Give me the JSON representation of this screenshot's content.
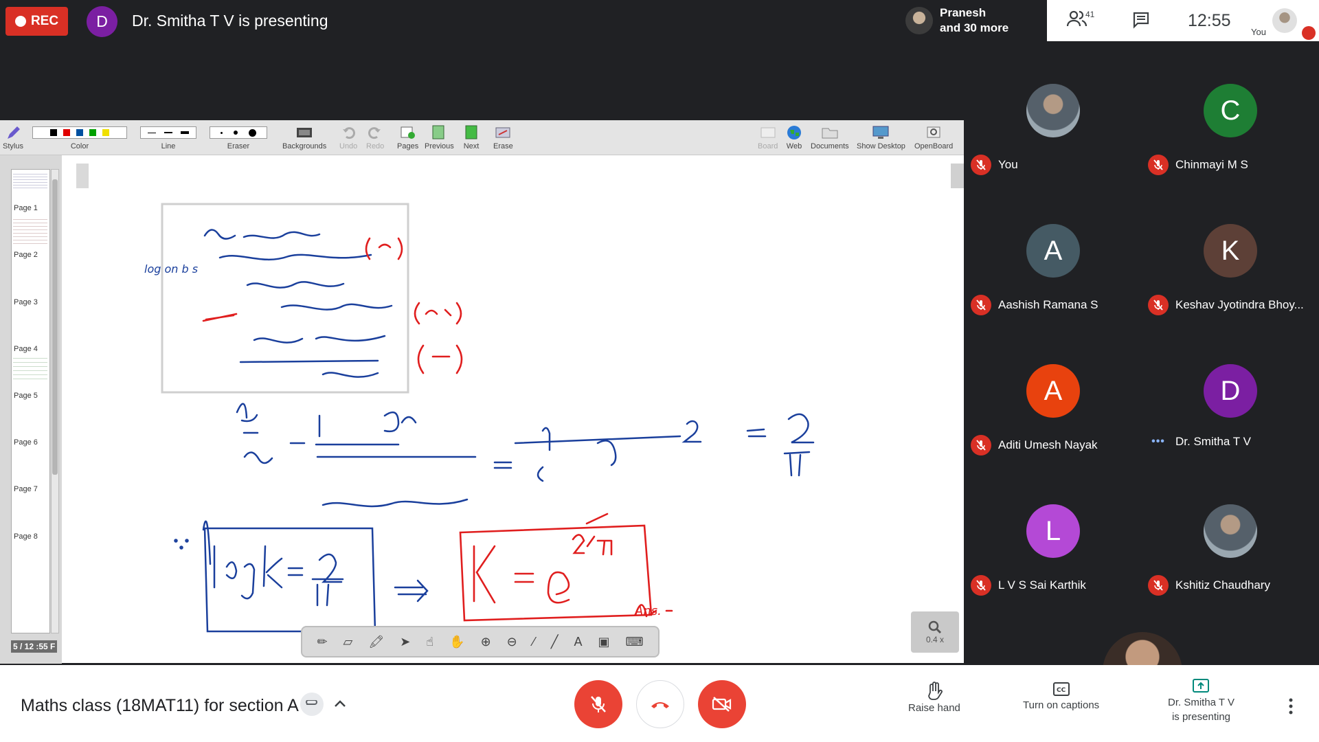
{
  "top_bar": {
    "rec_label": "REC",
    "presenter_initial": "D",
    "presenter_text": "Dr. Smitha T V is presenting",
    "speaker_line1": "Pranesh",
    "speaker_line2": "and 30 more",
    "participant_count": "41",
    "time": "12:55",
    "you_label": "You"
  },
  "whiteboard": {
    "toolbar_left": [
      {
        "label": "Stylus",
        "icon": "stylus-icon"
      },
      {
        "label": "Color",
        "icon": "color-swatches"
      },
      {
        "label": "Line",
        "icon": "line-width-icon"
      },
      {
        "label": "Eraser",
        "icon": "eraser-size-icon"
      },
      {
        "label": "Backgrounds",
        "icon": "backgrounds-icon"
      },
      {
        "label": "Undo",
        "icon": "undo-icon"
      },
      {
        "label": "Redo",
        "icon": "redo-icon"
      },
      {
        "label": "Pages",
        "icon": "pages-icon"
      },
      {
        "label": "Previous",
        "icon": "previous-icon"
      },
      {
        "label": "Next",
        "icon": "next-icon"
      },
      {
        "label": "Erase",
        "icon": "erase-icon"
      }
    ],
    "toolbar_right": [
      {
        "label": "Board",
        "icon": "board-icon"
      },
      {
        "label": "Web",
        "icon": "globe-icon"
      },
      {
        "label": "Documents",
        "icon": "folder-icon"
      },
      {
        "label": "Show Desktop",
        "icon": "desktop-icon"
      },
      {
        "label": "OpenBoard",
        "icon": "openboard-icon"
      }
    ],
    "colors": [
      "#000000",
      "#e00000",
      "#0050a0",
      "#00a000",
      "#f0e000"
    ],
    "pages": [
      "Page 1",
      "Page 2",
      "Page 3",
      "Page 4",
      "Page 5",
      "Page 6",
      "Page 7",
      "Page 8"
    ],
    "page_indicator": "5 / 12 :55 F",
    "zoom_label": "0.4 x",
    "note_left": "log on b s",
    "note_ans": "Ans."
  },
  "participants": [
    {
      "name": "You",
      "initial": "",
      "color": "#5f6368",
      "muted": true,
      "photo": true
    },
    {
      "name": "Chinmayi M S",
      "initial": "C",
      "color": "#1e7e34",
      "muted": true
    },
    {
      "name": "Aashish Ramana S",
      "initial": "A",
      "color": "#455a64",
      "muted": true
    },
    {
      "name": "Keshav Jyotindra Bhoy...",
      "initial": "K",
      "color": "#5d4037",
      "muted": true
    },
    {
      "name": "Aditi Umesh Nayak",
      "initial": "A",
      "color": "#e8420e",
      "muted": true
    },
    {
      "name": "Dr. Smitha T V",
      "initial": "D",
      "color": "#7b1fa2",
      "muted": false
    },
    {
      "name": "L V S Sai Karthik",
      "initial": "L",
      "color": "#b449d6",
      "muted": true
    },
    {
      "name": "Kshitiz Chaudhary",
      "initial": "",
      "color": "#cfd8dc",
      "muted": true,
      "photo": true
    }
  ],
  "bottom_bar": {
    "meeting_title": "Maths class (18MAT11) for section A",
    "raise_hand": "Raise hand",
    "captions": "Turn on captions",
    "presenting_line1": "Dr. Smitha T V",
    "presenting_line2": "is presenting"
  }
}
